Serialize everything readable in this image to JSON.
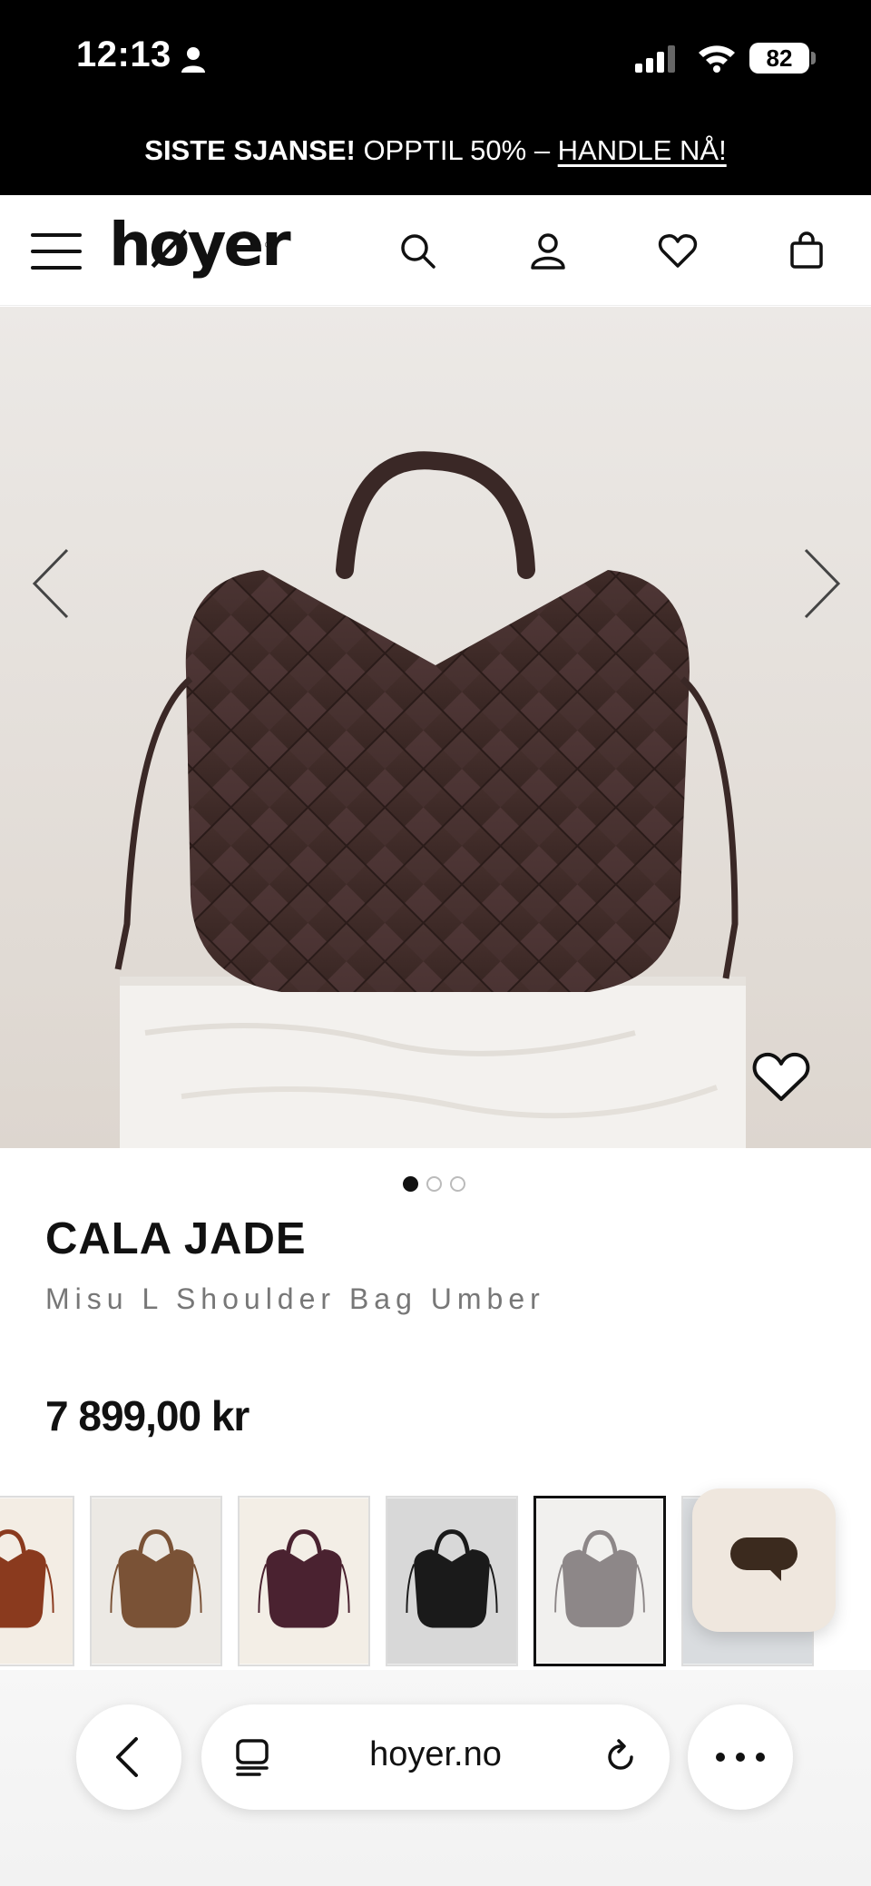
{
  "status_bar": {
    "time": "12:13",
    "battery": "82"
  },
  "promo": {
    "bold_text": "SISTE SJANSE!",
    "text": " OPPTIL 50% – ",
    "link": "HANDLE NÅ!"
  },
  "header": {
    "logo": "høyer"
  },
  "product": {
    "brand": "CALA JADE",
    "name": "Misu L Shoulder Bag Umber",
    "price": "7 899,00 kr",
    "gallery_total_images": 3,
    "gallery_active_index": 0
  },
  "swatches": [
    {
      "name": "cognac",
      "color": "#8a3a1e",
      "bg": "#f3ede4"
    },
    {
      "name": "tan",
      "color": "#7a5236",
      "bg": "#ece9e4"
    },
    {
      "name": "burgundy",
      "color": "#4a2230",
      "bg": "#f3eee6"
    },
    {
      "name": "black",
      "color": "#1a1a1a",
      "bg": "#d8d8d8"
    },
    {
      "name": "grey",
      "color": "#8d8788",
      "bg": "#f1f0ee",
      "selected": true
    },
    {
      "name": "light",
      "color": "#b8bcc0",
      "bg": "#d9dcdf"
    }
  ],
  "browser": {
    "url": "hoyer.no"
  },
  "colors": {
    "product_bag": "#3f2a26",
    "pedestal": "#f2f0ed",
    "chat_button": "#efe7de",
    "chat_icon": "#3b2a1e"
  }
}
